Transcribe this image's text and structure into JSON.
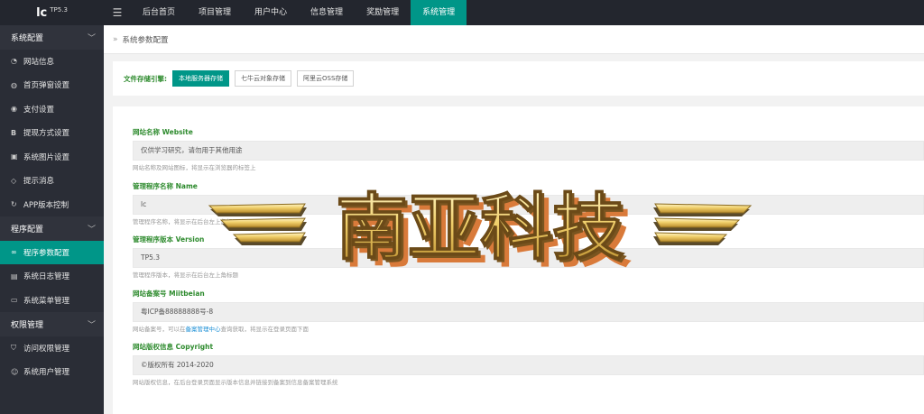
{
  "app": {
    "logo": "lc",
    "version": "TP5.3"
  },
  "topnav": {
    "items": [
      {
        "label": "后台首页"
      },
      {
        "label": "项目管理"
      },
      {
        "label": "用户中心"
      },
      {
        "label": "信息管理"
      },
      {
        "label": "奖励管理"
      },
      {
        "label": "系统管理",
        "active": true
      }
    ]
  },
  "sidebar": {
    "groups": [
      {
        "label": "系统配置",
        "items": [
          {
            "label": "网站信息",
            "icon": "gauge-icon"
          },
          {
            "label": "首页弹窗设置",
            "icon": "palette-icon"
          },
          {
            "label": "支付设置",
            "icon": "target-icon"
          },
          {
            "label": "提现方式设置",
            "icon": "bitcoin-icon"
          },
          {
            "label": "系统图片设置",
            "icon": "image-icon"
          },
          {
            "label": "提示消息",
            "icon": "tag-icon"
          },
          {
            "label": "APP版本控制",
            "icon": "refresh-icon"
          }
        ]
      },
      {
        "label": "程序配置",
        "items": [
          {
            "label": "程序参数配置",
            "icon": "link-icon",
            "active": true
          },
          {
            "label": "系统日志管理",
            "icon": "document-icon"
          },
          {
            "label": "系统菜单管理",
            "icon": "window-icon"
          }
        ]
      },
      {
        "label": "权限管理",
        "items": [
          {
            "label": "访问权限管理",
            "icon": "shield-check-icon"
          },
          {
            "label": "系统用户管理",
            "icon": "user-icon"
          }
        ]
      }
    ]
  },
  "breadcrumb": {
    "current": "系统参数配置"
  },
  "storage": {
    "label": "文件存储引擎:",
    "options": [
      {
        "label": "本地服务器存储",
        "active": true
      },
      {
        "label": "七牛云对象存储"
      },
      {
        "label": "阿里云OSS存储"
      }
    ]
  },
  "form": {
    "fields": [
      {
        "label": "网站名称 Website",
        "value": "仅供学习研究，请勿用于其他用途",
        "help": "网站名称及网站图标，将显示在浏览器的标签上"
      },
      {
        "label": "管理程序名称 Name",
        "value": "lc",
        "help": "管理程序名称，将显示在后台左上角标题"
      },
      {
        "label": "管理程序版本 Version",
        "value": "TP5.3",
        "help": "管理程序版本，将显示在后台左上角标题"
      },
      {
        "label": "网站备案号 Miitbeian",
        "value": "粤ICP备88888888号-8",
        "help_before": "网站备案号，可以在",
        "help_link": "备案管理中心",
        "help_after": "查询获取，将显示在登录页面下面"
      },
      {
        "label": "网站版权信息 Copyright",
        "value": "©版权所有 2014-2020",
        "help": "网站版权信息，在后台登录页面显示版本信息并链接到备案到信息备案管理系统"
      }
    ]
  },
  "watermark": {
    "text": "南亚科技"
  },
  "colors": {
    "accent": "#009688",
    "topbar": "#23262e",
    "sidebar": "#2a2d36",
    "label": "#2e8b2e",
    "link": "#1e90d6"
  }
}
